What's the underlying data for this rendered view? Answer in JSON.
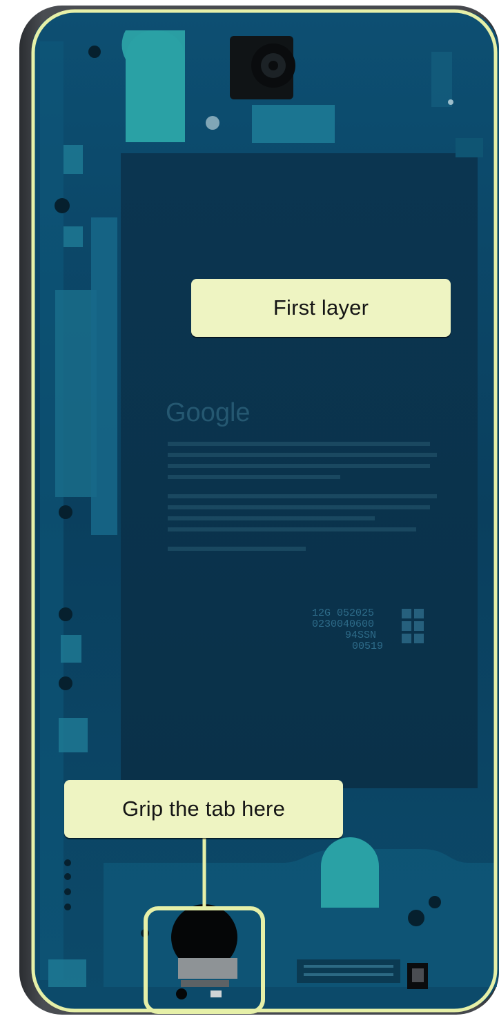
{
  "callouts": {
    "first_layer": "First layer",
    "grip_tab": "Grip the tab here"
  },
  "device_print": {
    "brand": "Google",
    "label_lines": [
      "12G 052025",
      "0230040600",
      "94SSN",
      "00519"
    ]
  },
  "colors": {
    "outline": "#e6f0a8",
    "callout_bg": "#eef4c2",
    "adhesive_blue": "#0c4d6e",
    "frame_gray": "#3a3d42"
  },
  "icons": {
    "camera": "rear-camera-module",
    "tab": "adhesive-pull-tab"
  }
}
